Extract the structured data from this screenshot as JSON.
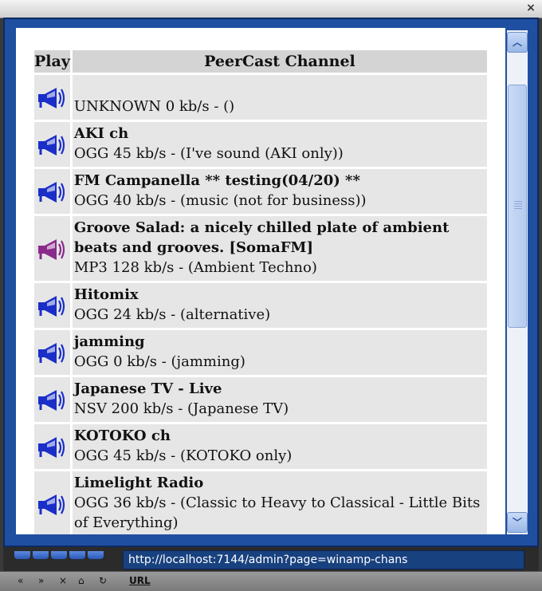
{
  "window": {
    "close_glyph": "×"
  },
  "table": {
    "col_play": "Play",
    "col_channel": "PeerCast Channel"
  },
  "channels": [
    {
      "name": "",
      "info": "UNKNOWN 0 kb/s - ()",
      "icon": "speaker-icon",
      "icon_color": "#1a2ec8"
    },
    {
      "name": "AKI ch",
      "info": "OGG 45 kb/s - (I've sound (AKI only))",
      "icon": "speaker-icon",
      "icon_color": "#1a2ec8"
    },
    {
      "name": "FM Campanella ** testing(04/20) **",
      "info": "OGG 40 kb/s - (music (not for business))",
      "icon": "speaker-icon",
      "icon_color": "#1a2ec8"
    },
    {
      "name": "Groove Salad: a nicely chilled plate of ambient beats and grooves. [SomaFM]",
      "info": "MP3 128 kb/s - (Ambient Techno)",
      "icon": "speaker-icon",
      "icon_color": "#8a2a8a"
    },
    {
      "name": "Hitomix",
      "info": "OGG 24 kb/s - (alternative)",
      "icon": "speaker-icon",
      "icon_color": "#1a2ec8"
    },
    {
      "name": "jamming",
      "info": "OGG 0 kb/s - (jamming)",
      "icon": "speaker-icon",
      "icon_color": "#1a2ec8"
    },
    {
      "name": "Japanese TV - Live",
      "info": "NSV 200 kb/s - (Japanese TV)",
      "icon": "speaker-icon",
      "icon_color": "#1a2ec8"
    },
    {
      "name": "KOTOKO ch",
      "info": "OGG 45 kb/s - (KOTOKO only)",
      "icon": "speaker-icon",
      "icon_color": "#1a2ec8"
    },
    {
      "name": "Limelight Radio",
      "info": "OGG 36 kb/s - (Classic to Heavy to Classical - Little Bits of Everything)",
      "icon": "speaker-icon",
      "icon_color": "#1a2ec8"
    }
  ],
  "scrollbar": {
    "up_glyph": "︿",
    "down_glyph": "﹀"
  },
  "address": {
    "url": "http://localhost:7144/admin?page=winamp-chans"
  },
  "nav": {
    "back": "«",
    "forward": "»",
    "stop": "×",
    "home": "⌂",
    "refresh": "↻",
    "url_label": "URL"
  }
}
